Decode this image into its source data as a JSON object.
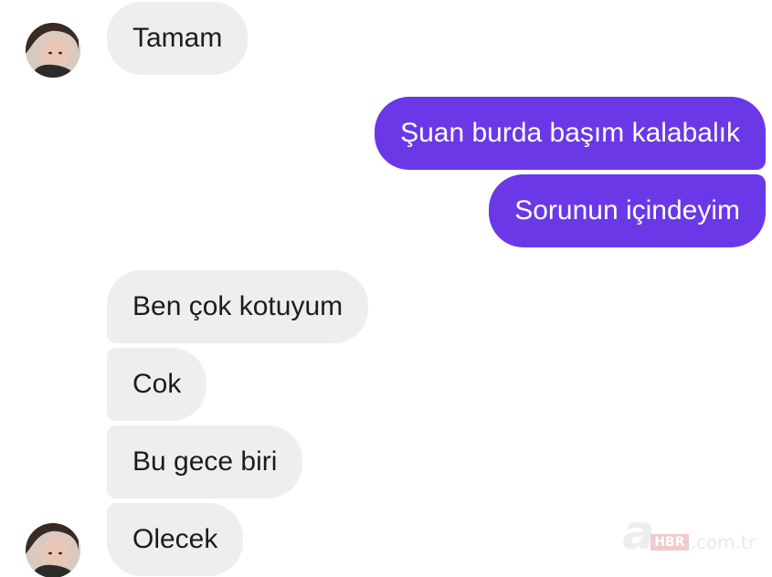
{
  "messages": [
    {
      "text": "Tamam"
    },
    {
      "text": "Şuan burda başım kalabalık"
    },
    {
      "text": "Sorunun içindeyim"
    },
    {
      "text": "Ben çok kotuyum"
    },
    {
      "text": "Cok"
    },
    {
      "text": "Bu gece biri"
    },
    {
      "text": "Olecek"
    }
  ],
  "watermark": {
    "logo": "a",
    "badge": "HBR",
    "domain": ".com.tr"
  },
  "colors": {
    "outgoing_bubble": "#6a38e6",
    "incoming_bubble": "#eeeeef"
  }
}
